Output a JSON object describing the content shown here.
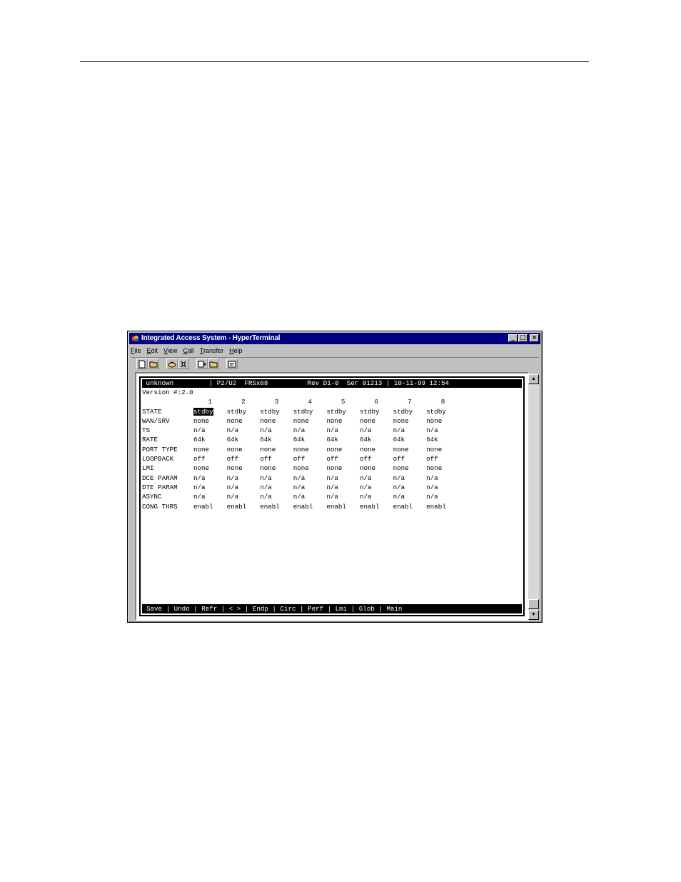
{
  "window": {
    "title": "Integrated Access System - HyperTerminal",
    "controls": {
      "minimize": "_",
      "maximize": "□",
      "close": "×"
    }
  },
  "menu": [
    "File",
    "Edit",
    "View",
    "Call",
    "Transfer",
    "Help"
  ],
  "toolbar_icons": [
    "new-icon",
    "open-icon",
    "connect-icon",
    "disconnect-icon",
    "send-icon",
    "receive-icon",
    "properties-icon"
  ],
  "terminal": {
    "status_bar": " unknown         | P2/U2  FRSx68          Rev D1-0  Ser 01213 | 10-11-99 12:54",
    "version": "Version #:2.0",
    "columns": [
      "1",
      "2",
      "3",
      "4",
      "5",
      "6",
      "7",
      "8"
    ],
    "rows": [
      {
        "label": "STATE",
        "values": [
          "stdby",
          "stdby",
          "stdby",
          "stdby",
          "stdby",
          "stdby",
          "stdby",
          "stdby"
        ]
      },
      {
        "label": "WAN/SRV",
        "values": [
          "none",
          "none",
          "none",
          "none",
          "none",
          "none",
          "none",
          "none"
        ]
      },
      {
        "label": "TS",
        "values": [
          "n/a",
          "n/a",
          "n/a",
          "n/a",
          "n/a",
          "n/a",
          "n/a",
          "n/a"
        ]
      },
      {
        "label": "RATE",
        "values": [
          "64k",
          "64k",
          "64k",
          "64k",
          "64k",
          "64k",
          "64k",
          "64k"
        ]
      },
      {
        "label": "PORT TYPE",
        "values": [
          "none",
          "none",
          "none",
          "none",
          "none",
          "none",
          "none",
          "none"
        ]
      },
      {
        "label": "LOOPBACK",
        "values": [
          "off",
          "off",
          "off",
          "off",
          "off",
          "off",
          "off",
          "off"
        ]
      },
      {
        "label": "LMI",
        "values": [
          "none",
          "none",
          "none",
          "none",
          "none",
          "none",
          "none",
          "none"
        ]
      },
      {
        "label": "DCE PARAM",
        "values": [
          "n/a",
          "n/a",
          "n/a",
          "n/a",
          "n/a",
          "n/a",
          "n/a",
          "n/a"
        ]
      },
      {
        "label": "DTE PARAM",
        "values": [
          "n/a",
          "n/a",
          "n/a",
          "n/a",
          "n/a",
          "n/a",
          "n/a",
          "n/a"
        ]
      },
      {
        "label": "ASYNC",
        "values": [
          "n/a",
          "n/a",
          "n/a",
          "n/a",
          "n/a",
          "n/a",
          "n/a",
          "n/a"
        ]
      },
      {
        "label": "CONG THRS",
        "values": [
          "enabl",
          "enabl",
          "enabl",
          "enabl",
          "enabl",
          "enabl",
          "enabl",
          "enabl"
        ]
      }
    ],
    "command_bar": "Save | Undo | Refr | < > | Endp | Circ | Perf | Lmi | Glob | Main"
  },
  "scrollbar": {
    "up": "▲",
    "down": "▼"
  }
}
